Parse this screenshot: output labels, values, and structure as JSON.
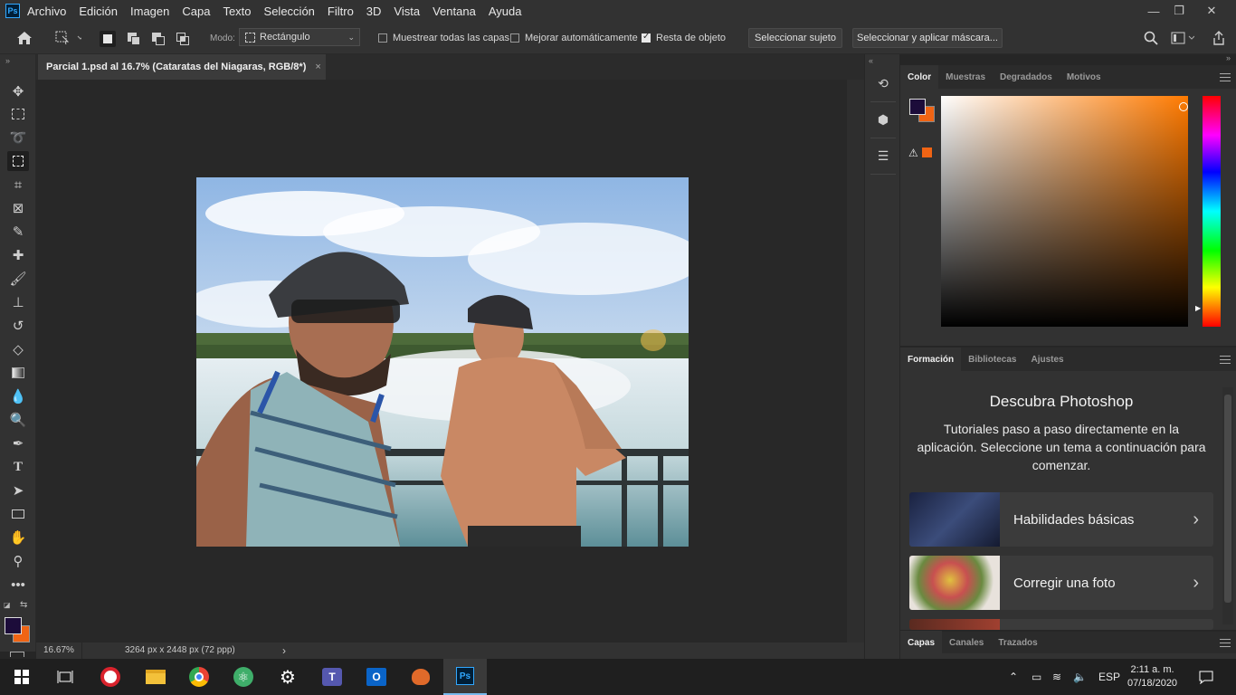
{
  "app": {
    "logo": "Ps",
    "menu": [
      "Archivo",
      "Edición",
      "Imagen",
      "Capa",
      "Texto",
      "Selección",
      "Filtro",
      "3D",
      "Vista",
      "Ventana",
      "Ayuda"
    ],
    "window_controls": [
      "minimize-icon",
      "restore-icon",
      "close-icon"
    ]
  },
  "options": {
    "mode_label": "Modo:",
    "mode_value": "Rectángulo",
    "sample_all_layers": "Muestrear todas las capas",
    "sample_all_layers_checked": false,
    "auto_enhance": "Mejorar automáticamente",
    "auto_enhance_checked": false,
    "object_subtract": "Resta de objeto",
    "object_subtract_checked": true,
    "select_subject": "Seleccionar sujeto",
    "select_and_mask": "Seleccionar y aplicar máscara..."
  },
  "document": {
    "tab_title": "Parcial 1.psd al 16.7% (Cataratas del Niagaras, RGB/8*)",
    "close": "×"
  },
  "status": {
    "zoom": "16.67%",
    "dimensions": "3264 px x 2448 px (72 ppp)",
    "arrow": "›"
  },
  "color_panel": {
    "tabs": [
      "Color",
      "Muestras",
      "Degradados",
      "Motivos"
    ],
    "active_tab": "Color",
    "foreground": "#1c0c3a",
    "background": "#f06414",
    "hue": "#ff7a00"
  },
  "learn_panel": {
    "tabs": [
      "Formación",
      "Bibliotecas",
      "Ajustes"
    ],
    "active_tab": "Formación",
    "heading": "Descubra Photoshop",
    "description": "Tutoriales paso a paso directamente en la aplicación. Seleccione un tema a continuación para comenzar.",
    "items": [
      {
        "label": "Habilidades básicas",
        "chevron": "›"
      },
      {
        "label": "Corregir una foto",
        "chevron": "›"
      }
    ]
  },
  "layers_panel": {
    "tabs": [
      "Capas",
      "Canales",
      "Trazados"
    ],
    "active_tab": "Capas"
  },
  "taskbar": {
    "language": "ESP",
    "time": "2:11 a. m.",
    "date": "07/18/2020"
  }
}
